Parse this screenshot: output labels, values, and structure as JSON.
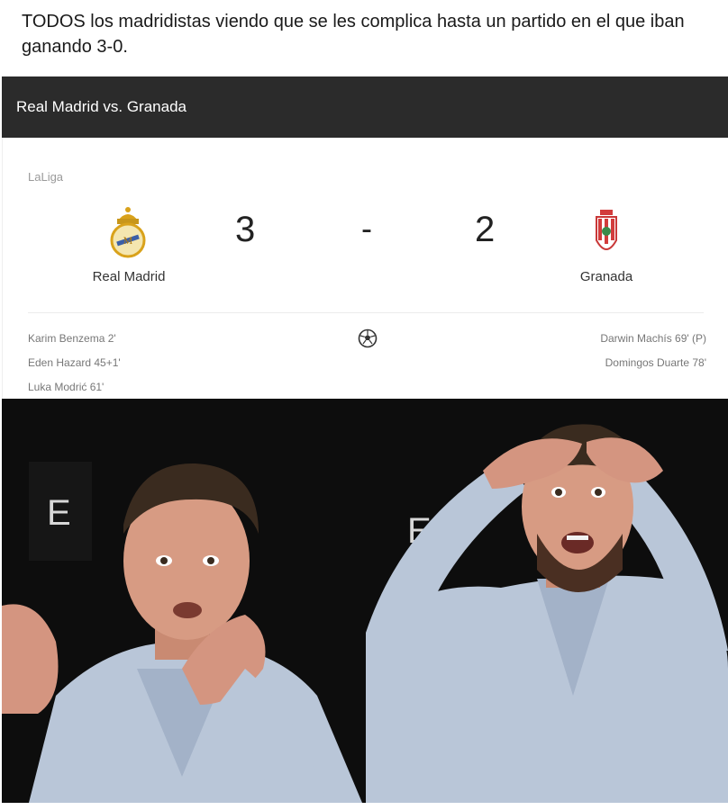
{
  "post": {
    "caption": "TODOS los madridistas viendo que se les complica hasta un partido en el que iban ganando 3-0."
  },
  "match": {
    "title": "Real Madrid vs. Granada",
    "league": "LaLiga",
    "home_team": "Real Madrid",
    "away_team": "Granada",
    "home_score": "3",
    "separator": "-",
    "away_score": "2",
    "home_scorers": [
      "Karim Benzema 2'",
      "Eden Hazard 45+1'",
      "Luka Modrić 61'"
    ],
    "away_scorers": [
      "Darwin Machís 69' (P)",
      "Domingos Duarte 78'"
    ],
    "icons": {
      "home_crest": "real-madrid-crest-icon",
      "away_crest": "granada-crest-icon",
      "goal": "soccer-ball-icon"
    }
  },
  "colors": {
    "header_bg": "#2b2b2b",
    "photo_bg": "#0d0d0d",
    "shirt": "#b9c6d8",
    "skin": "#d79b83"
  }
}
